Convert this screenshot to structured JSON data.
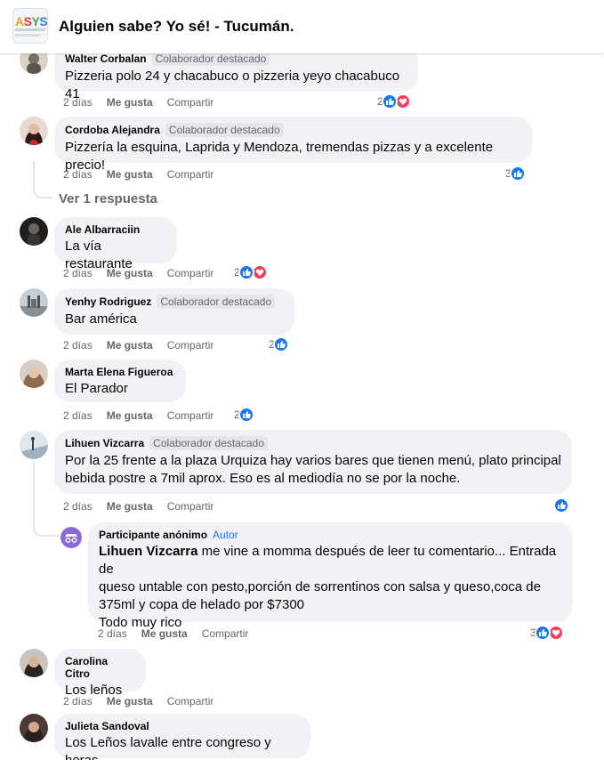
{
  "header": {
    "title": "Alguien sabe? Yo sé! - Tucumán.",
    "logo_text": "ASYS"
  },
  "comments": [
    {
      "author": "Walter Corbalan",
      "badge": "Colaborador destacado",
      "text": "Pizzeria polo 24 y chacabuco o pizzeria yeyo chacabuco 41",
      "time": "2 días",
      "like": "Me gusta",
      "reply": "Compartir",
      "reactions_count": "2"
    },
    {
      "author": "Cordoba Alejandra",
      "badge": "Colaborador destacado",
      "text": "Pizzería la esquina, Laprida y Mendoza, tremendas pizzas y a excelente precio!",
      "time": "2 días",
      "like": "Me gusta",
      "reply": "Compartir",
      "reactions_count": "3",
      "more_replies": "Ver 1 respuesta"
    },
    {
      "author": "Ale Albarraciin",
      "badge": "",
      "text": "La vía restaurante",
      "time": "2 días",
      "like": "Me gusta",
      "reply": "Compartir",
      "reactions_count": "2"
    },
    {
      "author": "Yenhy Rodriguez",
      "badge": "Colaborador destacado",
      "text": "Bar américa",
      "time": "2 días",
      "like": "Me gusta",
      "reply": "Compartir",
      "reactions_count": "2"
    },
    {
      "author": "Marta Elena Figueroa",
      "badge": "",
      "text": "El Parador",
      "time": "2 días",
      "like": "Me gusta",
      "reply": "Compartir",
      "reactions_count": "2"
    },
    {
      "author": "Lihuen Vizcarra",
      "badge": "Colaborador destacado",
      "text_line1": "Por la 25 frente a la plaza Urquiza hay varios bares que tienen menú, plato principal",
      "text_line2": "bebida postre a 7mil aprox. Eso es al mediodía no se por la noche.",
      "time": "2 días",
      "like": "Me gusta",
      "reply": "Compartir",
      "reactions_count": ""
    },
    {
      "author": "Carolina Citro",
      "badge": "",
      "text": "Los leños",
      "time": "2 días",
      "like": "Me gusta",
      "reply": "Compartir"
    },
    {
      "author": "Julieta Sandoval",
      "badge": "",
      "text": "Los Leños lavalle entre congreso y heras"
    }
  ],
  "reply": {
    "author": "Participante anónimo",
    "badge": "Autor",
    "mention": "Lihuen Vizcarra",
    "line1": " me vine a momma después de leer tu comentario... Entrada de",
    "line2": "queso untable con pesto,porción de sorrentinos con salsa y queso,coca de",
    "line3": "375ml y copa de helado por $7300",
    "line4": "Todo muy rico",
    "time": "2 días",
    "like": "Me gusta",
    "reply_label": "Compartir",
    "reactions_count": "3"
  },
  "colors": {
    "like": "#1877f2",
    "love": "#f33e58",
    "bubble": "#f0f2f5",
    "secondary_text": "#65676b",
    "author_badge": "#1b74e4"
  },
  "icons": {
    "like": "thumbs-up-icon",
    "love": "heart-icon",
    "anonymous": "anonymous-avatar-icon"
  }
}
